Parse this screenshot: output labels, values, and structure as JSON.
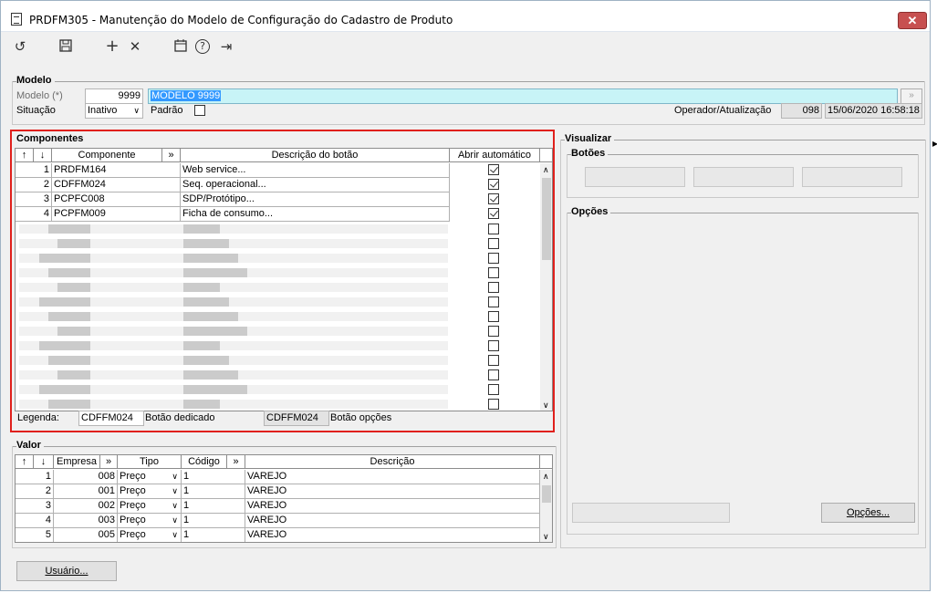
{
  "window": {
    "title": "PRDFM305 - Manutenção do Modelo de Configuração do Cadastro de Produto",
    "close": "✕"
  },
  "toolbar": {
    "undo": "↺",
    "save": "💾",
    "add": "+",
    "delete": "✕",
    "calendar": "📅",
    "help": "?",
    "exit": "⇥"
  },
  "modelo": {
    "group_label": "Modelo",
    "modelo_label": "Modelo (*)",
    "modelo_code": "9999",
    "modelo_desc": "MODELO 9999",
    "situacao_label": "Situação",
    "situacao_value": "Inativo",
    "padrao_label": "Padrão",
    "operador_label": "Operador/Atualização",
    "operador_value": "098",
    "atualizacao_value": "15/06/2020 16:58:18"
  },
  "componentes": {
    "group_label": "Componentes",
    "headers": {
      "up": "↑",
      "down": "↓",
      "componente": "Componente",
      "more": "»",
      "descricao": "Descrição do botão",
      "abrir": "Abrir automático"
    },
    "rows": [
      {
        "n": "1",
        "componente": "PRDFM164",
        "descricao": "Web service...",
        "abrir": true
      },
      {
        "n": "2",
        "componente": "CDFFM024",
        "descricao": "Seq. operacional...",
        "abrir": true
      },
      {
        "n": "3",
        "componente": "PCPFC008",
        "descricao": "SDP/Protótipo...",
        "abrir": true
      },
      {
        "n": "4",
        "componente": "PCPFM009",
        "descricao": "Ficha de consumo...",
        "abrir": true
      }
    ],
    "legenda_label": "Legenda:",
    "legenda_dedicado_code": "CDFFM024",
    "legenda_dedicado_label": "Botão dedicado",
    "legenda_opcoes_code": "CDFFM024",
    "legenda_opcoes_label": "Botão opções"
  },
  "valor": {
    "group_label": "Valor",
    "headers": {
      "up": "↑",
      "down": "↓",
      "empresa": "Empresa",
      "more": "»",
      "tipo": "Tipo",
      "codigo": "Código",
      "more2": "»",
      "descricao": "Descrição"
    },
    "rows": [
      {
        "n": "1",
        "empresa": "008",
        "tipo": "Preço",
        "codigo": "1",
        "descricao": "VAREJO"
      },
      {
        "n": "2",
        "empresa": "001",
        "tipo": "Preço",
        "codigo": "1",
        "descricao": "VAREJO"
      },
      {
        "n": "3",
        "empresa": "002",
        "tipo": "Preço",
        "codigo": "1",
        "descricao": "VAREJO"
      },
      {
        "n": "4",
        "empresa": "003",
        "tipo": "Preço",
        "codigo": "1",
        "descricao": "VAREJO"
      },
      {
        "n": "5",
        "empresa": "005",
        "tipo": "Preço",
        "codigo": "1",
        "descricao": "VAREJO"
      }
    ]
  },
  "visualizar": {
    "group_label": "Visualizar",
    "botoes_label": "Botões",
    "opcoes_label": "Opções",
    "opcoes_button": "Opções..."
  },
  "footer": {
    "usuario_button": "Usuário..."
  }
}
